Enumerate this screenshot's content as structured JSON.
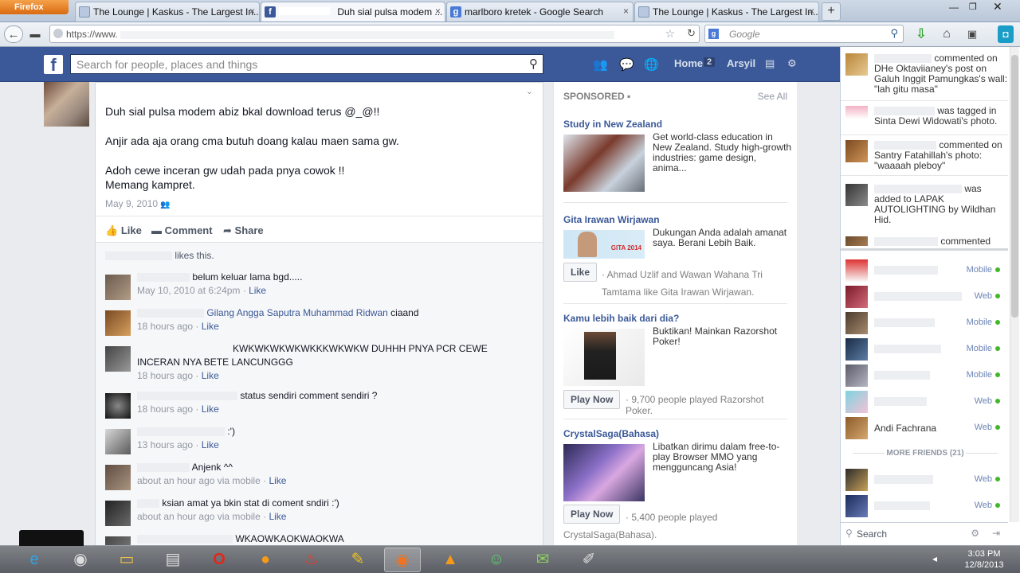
{
  "browser": {
    "menu_label": "Firefox",
    "tabs": [
      {
        "title": "The Lounge | Kaskus - The Largest In..."
      },
      {
        "title": "Duh sial pulsa modem ..."
      },
      {
        "title": "marlboro kretek - Google Search"
      },
      {
        "title": "The Lounge | Kaskus - The Largest In..."
      }
    ],
    "new_tab": "+",
    "url": "https://www.",
    "search_placeholder": "Google"
  },
  "facebook": {
    "logo": "f",
    "search_placeholder": "Search for people, places and things",
    "nav": {
      "home": "Home",
      "home_count": "2",
      "user": "Arsyil"
    },
    "post": {
      "lines": [
        "Duh sial pulsa modem abiz bkal download terus @_@!!",
        "Anjir ada aja orang cma butuh doang kalau maen sama gw.",
        "Adoh cewe inceran gw udah pada pnya cowok !!",
        "Memang kampret."
      ],
      "date": "May 9, 2010",
      "actions": {
        "like": "Like",
        "comment": "Comment",
        "share": "Share"
      },
      "likes_text": "likes this."
    },
    "comments": [
      {
        "text": "belum keluar lama bgd.....",
        "meta": "May 10, 2010 at 6:24pm",
        "like": "Like"
      },
      {
        "link": "Gilang Angga Saputra Muhammad Ridwan",
        "text": " ciaand",
        "meta": "18 hours ago",
        "like": "Like"
      },
      {
        "text": "KWKWKWKWKWKKKWKWKW DUHHH PNYA PCR CEWE INCERAN NYA BETE LANCUNGGG",
        "meta": "18 hours ago",
        "like": "Like"
      },
      {
        "text": "status sendiri comment sendiri ?",
        "meta": "18 hours ago",
        "like": "Like"
      },
      {
        "text": ":')",
        "meta": "13 hours ago",
        "like": "Like"
      },
      {
        "text": "Anjenk ^^",
        "meta": "about an hour ago via mobile",
        "like": "Like"
      },
      {
        "text": "ksian amat ya bkin stat di coment sndiri :')",
        "meta": "about an hour ago via mobile",
        "like": "Like"
      },
      {
        "text": "WKAOWKAOKWAOKWA",
        "meta": "",
        "like": ""
      }
    ],
    "sponsored": {
      "header": "SPONSORED",
      "see_all": "See All",
      "ads": [
        {
          "title": "Study in New Zealand",
          "text": "Get world-class education in New Zealand. Study high-growth industries: game design, anima...",
          "button": "",
          "sub": ""
        },
        {
          "title": "Gita Irawan Wirjawan",
          "text": "Dukungan Anda adalah amanat saya. Berani Lebih Baik.",
          "button": "Like",
          "sub": "· Ahmad Uzlif and Wawan Wahana Tri Tamtama like Gita Irawan Wirjawan.",
          "img_caption": "GITA 2014"
        },
        {
          "title": "Kamu lebih baik dari dia?",
          "text": "Buktikan! Mainkan Razorshot Poker!",
          "button": "Play Now",
          "sub": "· 9,700 people played Razorshot Poker."
        },
        {
          "title": "CrystalSaga(Bahasa)",
          "text": "Libatkan dirimu dalam free-to-play Browser MMO yang mengguncang Asia!",
          "button": "Play Now",
          "sub": "· 5,400 people played CrystalSaga(Bahasa)."
        }
      ]
    },
    "ticker": [
      {
        "text": "commented on DHe Oktaviianey's post on Galuh Inggit Pamungkas's wall: \"lah gitu masa\""
      },
      {
        "text": "was tagged in Sinta Dewi Widowati's photo."
      },
      {
        "text": "commented on Santry Fatahillah's photo: \"waaaah pleboy\""
      },
      {
        "text": "was added to LAPAK AUTOLIGHTING by Wildhan Hid."
      },
      {
        "text": "commented"
      }
    ],
    "chat": {
      "friends": [
        {
          "name": "",
          "status": "Mobile"
        },
        {
          "name": "",
          "status": "Web"
        },
        {
          "name": "",
          "status": "Mobile"
        },
        {
          "name": "",
          "status": "Mobile"
        },
        {
          "name": "",
          "status": "Mobile"
        },
        {
          "name": "",
          "status": "Web"
        },
        {
          "name": "Andi Fachrana",
          "status": "Web"
        }
      ],
      "more_friends": "MORE FRIENDS (21)",
      "more": [
        {
          "status": "Web"
        },
        {
          "status": "Web"
        }
      ],
      "search": "Search"
    }
  },
  "taskbar": {
    "time": "3:03 PM",
    "date": "12/8/2013"
  }
}
